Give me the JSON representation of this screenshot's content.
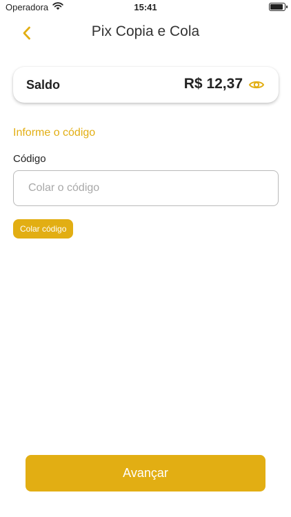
{
  "status_bar": {
    "carrier": "Operadora",
    "time": "15:41",
    "wifi_icon": "wifi-icon",
    "battery_icon": "battery-icon"
  },
  "header": {
    "back_icon": "chevron-left-icon",
    "title": "Pix Copia e Cola"
  },
  "balance": {
    "label": "Saldo",
    "value": "R$ 12,37",
    "toggle_icon": "eye-icon"
  },
  "form": {
    "section_title": "Informe o código",
    "field_label": "Código",
    "code_value": "",
    "code_placeholder": "Colar o código",
    "paste_label": "Colar código"
  },
  "footer": {
    "next_label": "Avançar"
  },
  "colors": {
    "accent": "#E2AE13",
    "text": "#222222",
    "placeholder": "#A8A8A8",
    "border": "#B9B9B9"
  }
}
